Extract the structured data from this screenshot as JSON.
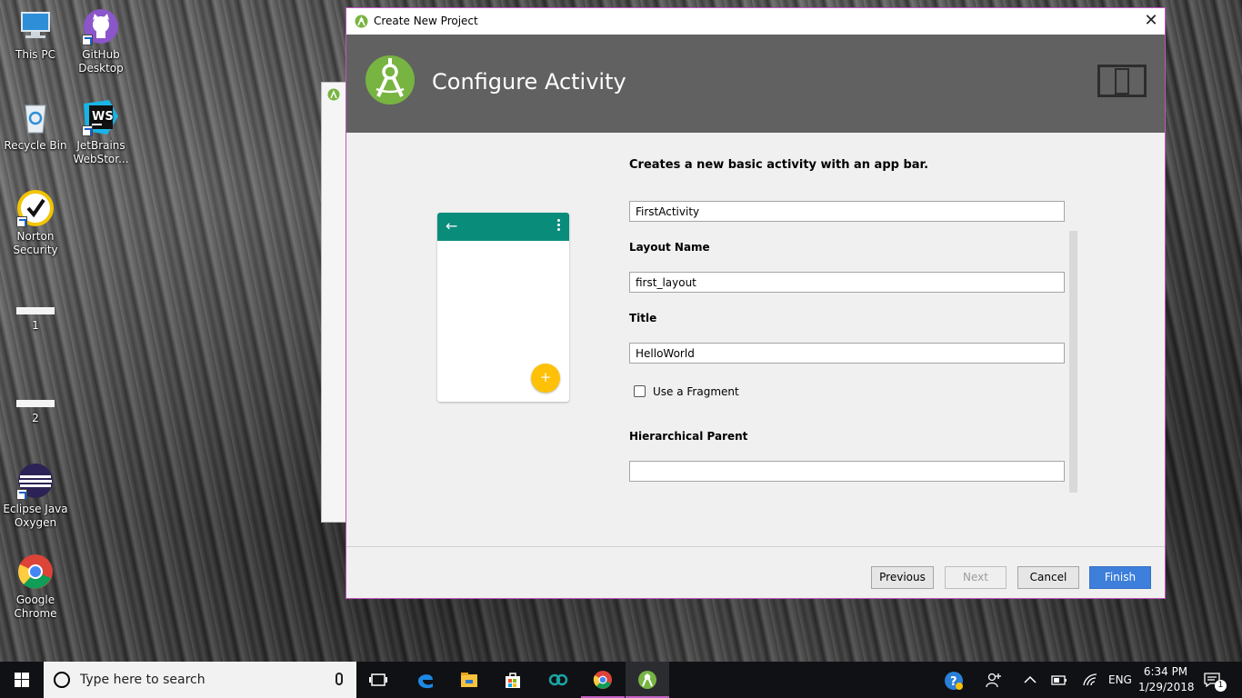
{
  "desktop": {
    "icons": [
      {
        "label": "This PC",
        "icon": "computer-icon"
      },
      {
        "label": "GitHub Desktop",
        "icon": "github-icon"
      },
      {
        "label": "Recycle Bin",
        "icon": "recycle-bin-icon"
      },
      {
        "label": "JetBrains WebStor...",
        "icon": "webstorm-icon"
      },
      {
        "label": "Norton Security",
        "icon": "norton-icon"
      },
      {
        "label": "1",
        "icon": "blank-file-icon"
      },
      {
        "label": "2",
        "icon": "blank-file-icon"
      },
      {
        "label": "Eclipse Java Oxygen",
        "icon": "eclipse-icon"
      },
      {
        "label": "Google Chrome",
        "icon": "chrome-icon"
      }
    ]
  },
  "dialog": {
    "window_title": "Create New Project",
    "close_glyph": "✕",
    "header_title": "Configure Activity",
    "description": "Creates a new basic activity with an app bar.",
    "activity_name_value": "FirstActivity",
    "layout_name_label": "Layout Name",
    "layout_name_value": "first_layout",
    "title_label": "Title",
    "title_value": "HelloWorld",
    "use_fragment_label": "Use a Fragment",
    "use_fragment_checked": false,
    "hierarchical_parent_label": "Hierarchical Parent",
    "hierarchical_parent_value": "",
    "preview": {
      "back_glyph": "←",
      "fab_glyph": "+",
      "appbar_color": "#0a8c7b",
      "fab_color": "#ffc107"
    },
    "buttons": {
      "previous": "Previous",
      "next": "Next",
      "cancel": "Cancel",
      "finish": "Finish"
    },
    "accent_color": "#3d7fdb",
    "header_color": "#616161"
  },
  "taskbar": {
    "search_placeholder": "Type here to search",
    "language": "ENG",
    "time": "6:34 PM",
    "date": "1/29/2018",
    "notification_count": "1",
    "apps": [
      "task-view-icon",
      "edge-icon",
      "file-explorer-icon",
      "store-icon",
      "arduino-icon",
      "chrome-icon",
      "android-studio-icon"
    ]
  }
}
